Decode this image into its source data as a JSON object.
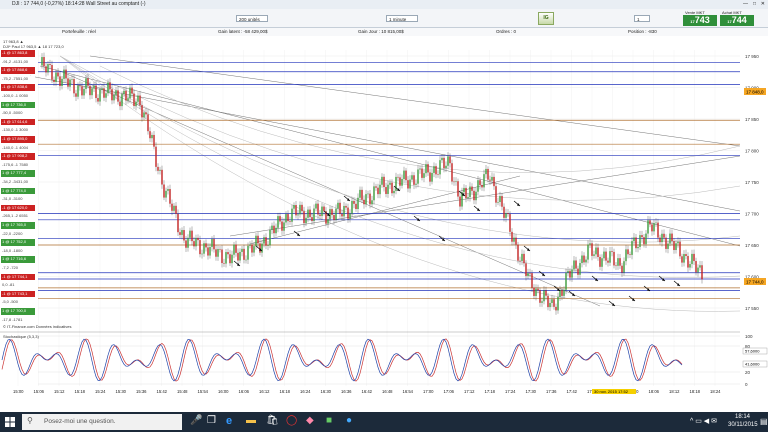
{
  "window": {
    "title": "DJI : 17 744,0 (-0,27%)  18:14:28  Wall Street au comptant (-)"
  },
  "toolbar": {
    "units": "200 unités",
    "interval": "1 minute",
    "app_logo": "IG",
    "qty": "1",
    "sell_label": "Vente MKT",
    "buy_label": "Achat MKT",
    "sell_price": "743",
    "buy_price": "744",
    "sell_prefix": "17",
    "buy_prefix": "17"
  },
  "info": {
    "portfolio": "Portefeuille : réel",
    "gain_latent": "Gain latent : -58 429,00$",
    "gain_jour": "Gain Jour : 10 815,00$",
    "ordres": "Ordres : 0",
    "position": "Position : -830"
  },
  "chart_header": {
    "line1": "17 963,8  ▲",
    "line2": "DJI* Paul  17 963,5  ▲ 18 17 723,0",
    "source": "© IT-Finance.com  Données indicatives",
    "stoch": "Stochastique (5,3,3)"
  },
  "order_panel": [
    {
      "label": "-1 @ 17 863,8",
      "kind": "red"
    },
    {
      "label": "-91,2   -4131,00",
      "kind": "gray"
    },
    {
      "label": "-1 @ 17 868,6",
      "kind": "red"
    },
    {
      "label": "-75,2   -7551,00",
      "kind": "gray"
    },
    {
      "label": "-1 @ 17 838,6",
      "kind": "red"
    },
    {
      "label": "-100,0   -1 0050",
      "kind": "gray"
    },
    {
      "label": "1 @ 17 736,0",
      "kind": "green"
    },
    {
      "label": "-50,0   -5000",
      "kind": "gray"
    },
    {
      "label": "-1 @ 17 614,6",
      "kind": "red"
    },
    {
      "label": "-130,0   -1 3000",
      "kind": "gray"
    },
    {
      "label": "-1 @ 17 895,0",
      "kind": "red"
    },
    {
      "label": "-140,0   -1 4004",
      "kind": "gray"
    },
    {
      "label": "-1 @ 17 908,2",
      "kind": "red"
    },
    {
      "label": "-175,6   -1 7580",
      "kind": "gray"
    },
    {
      "label": "1 @ 17 777,4",
      "kind": "green"
    },
    {
      "label": "-34,2   -3431,00",
      "kind": "gray"
    },
    {
      "label": "1 @ 17 774,0",
      "kind": "green"
    },
    {
      "label": "-31,0   -3100",
      "kind": "gray"
    },
    {
      "label": "-1 @ 17 620,0",
      "kind": "red"
    },
    {
      "label": "-265,1   -2 6551",
      "kind": "gray"
    },
    {
      "label": "1 @ 17 765,0",
      "kind": "green"
    },
    {
      "label": "-22,0   -2200",
      "kind": "gray"
    },
    {
      "label": "1 @ 17 752,0",
      "kind": "green"
    },
    {
      "label": "-18,0   -1800",
      "kind": "gray"
    },
    {
      "label": "1 @ 17 716,6",
      "kind": "green"
    },
    {
      "label": "-7,2   -720",
      "kind": "gray"
    },
    {
      "label": "-1 @ 17 744,1",
      "kind": "red"
    },
    {
      "label": "0,0   -81",
      "kind": "gray"
    },
    {
      "label": "-1 @ 17 743,1",
      "kind": "red"
    },
    {
      "label": "-5,0   -500",
      "kind": "gray"
    },
    {
      "label": "1 @ 17 700,0",
      "kind": "green"
    },
    {
      "label": "-17,8   -1781",
      "kind": "gray"
    }
  ],
  "price_labels": [
    "17 950",
    "17 900",
    "17 850",
    "17 800",
    "17 750",
    "17 700",
    "17 650",
    "17 600",
    "17 550"
  ],
  "right_badges": {
    "top": "17 848,0",
    "current": "17 744,0"
  },
  "stoch_labels": [
    "100",
    "80",
    "20",
    "0"
  ],
  "stoch_values": {
    "a": "57,6000",
    "b": "41,6000"
  },
  "time_labels": [
    "15:00",
    "15:06",
    "15:12",
    "15:18",
    "15:24",
    "15:30",
    "15:36",
    "15:42",
    "15:48",
    "15:54",
    "16:00",
    "16:06",
    "16:12",
    "16:18",
    "16:24",
    "16:30",
    "16:36",
    "16:42",
    "16:48",
    "16:54",
    "17:00",
    "17:06",
    "17:12",
    "17:18",
    "17:24",
    "17:30",
    "17:36",
    "17:42",
    "17:48",
    "17:54",
    "18:00",
    "18:06",
    "18:12",
    "18:18",
    "18:24"
  ],
  "time_highlight": "30 nov. 2015 17:52",
  "taskbar": {
    "search": "Posez-moi une question.",
    "time": "18:14",
    "date": "30/11/2015"
  },
  "colors": {
    "up": "#3a9a3a",
    "down": "#c22222",
    "hline_blue": "#2233bb",
    "hline_brown": "#b07030",
    "stoch_main": "#2244aa",
    "stoch_signal": "#cc3333"
  }
}
